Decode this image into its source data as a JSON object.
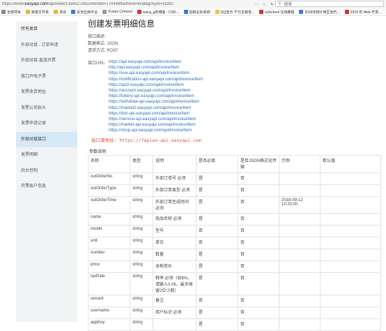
{
  "browser": {
    "url_prefix": "https://www.",
    "url_domain": "easyapi.com",
    "url_rest": "/api/view/1359527documentId=170448themeId=8categoryId=31982",
    "search_placeholder": "搜索"
  },
  "bookmarks": [
    {
      "label": "全部项目",
      "color": "#888888"
    },
    {
      "label": "新建文件夹",
      "color": "#e8b73a"
    },
    {
      "label": "测试",
      "color": "#e8b73a"
    },
    {
      "label": "青天应用平台",
      "color": "#3a7bd5"
    },
    {
      "label": "iTunes Connect",
      "color": "#999999"
    },
    {
      "label": "wang_g的博客 - CSD...",
      "color": "#d9342b"
    },
    {
      "label": "拍取业标系统",
      "color": "#3a7bd5"
    },
    {
      "label": "QQ音乐-千万正版音...",
      "color": "#f2c14e"
    },
    {
      "label": "w3school 在线教程",
      "color": "#cc3333"
    },
    {
      "label": "2018年统计用区划代...",
      "color": "#3a7bd5"
    },
    {
      "label": "2019 年 Web 开发...",
      "color": "#cc3333"
    }
  ],
  "sidebar": {
    "items": [
      {
        "label": "所有类目",
        "state": "head"
      },
      {
        "label": "外部对接 - 订单申请",
        "state": ""
      },
      {
        "label": "外部对接-直接开票",
        "state": ""
      },
      {
        "label": "接口开电子票",
        "state": ""
      },
      {
        "label": "发票收货地址",
        "state": ""
      },
      {
        "label": "发票公司抬头",
        "state": ""
      },
      {
        "label": "发票申请记录",
        "state": ""
      },
      {
        "label": "外部对接接口",
        "state": "active"
      },
      {
        "label": "发票明细",
        "state": ""
      },
      {
        "label": "后台控制",
        "state": ""
      },
      {
        "label": "开票账户信息",
        "state": ""
      }
    ]
  },
  "main": {
    "title": "创建发票明细信息",
    "desc_label": "接口描述:",
    "format_label": "数据格式:",
    "format_value": "JSON",
    "method_label": "请求方式:",
    "method_value": "POST",
    "url_label": "接口URL:",
    "urls": [
      "https://api.easyapi.com/api/invoice/item",
      "http://api.easyapi.com/api/invoice/item",
      "https://vue.api.easyapi.com/api/invoice/item",
      "https://notification-api.easyapi.com/api/invoice/item",
      "https://api2.easyapi.com/api/invoice/item",
      "https://account.easyapi.com/api/invoice/item",
      "https://lottery-api.easyapi.com/api/invoice/item",
      "https://withdraw-api.easyapi.com/api/invoice/item",
      "https://market2.easyapi.com/api/invoice/item",
      "https://doc-api.easyapi.com/api/invoice/item",
      "https://service-api.easyapi.com/api/invoice/item",
      "https://market-api.easyapi.com/api/invoice/item",
      "https://shop-api.easyapi.com/api/invoice/item"
    ],
    "note": "接口源地址: https://fapiao-api.easyapi.com",
    "params_title": "参数说明",
    "headers": [
      "名称",
      "类型",
      "说明",
      "是否必填",
      "是否JSON格式化传输",
      "示例",
      "默认值"
    ],
    "rows": [
      {
        "cells": [
          "outOrderNo",
          "string",
          "外部订单号 必须",
          "是",
          "否",
          "",
          ""
        ],
        "size": ""
      },
      {
        "cells": [
          "outOrderType",
          "string",
          "外部订单类型 必须",
          "是",
          "否",
          "",
          ""
        ],
        "size": ""
      },
      {
        "cells": [
          "outOrderTime",
          "string",
          "外部订单生成时间 必须",
          "是",
          "否",
          "2018-09-12 10:20:00",
          ""
        ],
        "size": "tall"
      },
      {
        "cells": [
          "name",
          "string",
          "商品名称 必须",
          "是",
          "否",
          "",
          ""
        ],
        "size": ""
      },
      {
        "cells": [
          "model",
          "string",
          "型号",
          "否",
          "否",
          "",
          ""
        ],
        "size": ""
      },
      {
        "cells": [
          "unit",
          "string",
          "单位",
          "否",
          "否",
          "",
          ""
        ],
        "size": ""
      },
      {
        "cells": [
          "number",
          "string",
          "数量",
          "是",
          "否",
          "",
          ""
        ],
        "size": ""
      },
      {
        "cells": [
          "price",
          "string",
          "含税单价",
          "是",
          "否",
          "",
          ""
        ],
        "size": ""
      },
      {
        "cells": [
          "taxRate",
          "string",
          "税率 必须（如6%，请输入0.06，最多保留2位小数）",
          "是",
          "否",
          "",
          ""
        ],
        "size": "xtall"
      },
      {
        "cells": [
          "remark",
          "string",
          "备注",
          "否",
          "否",
          "",
          ""
        ],
        "size": ""
      },
      {
        "cells": [
          "username",
          "string",
          "用户标识 必须",
          "是",
          "否",
          "",
          ""
        ],
        "size": ""
      },
      {
        "cells": [
          "appKey",
          "string",
          "",
          "是",
          "否",
          "",
          ""
        ],
        "size": ""
      }
    ]
  }
}
